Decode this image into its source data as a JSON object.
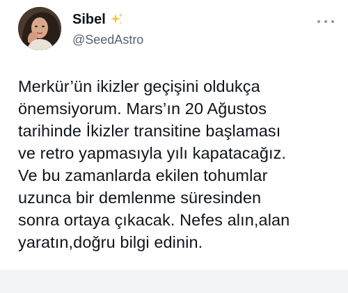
{
  "tweet": {
    "author": {
      "display_name": "Sibel",
      "name_emoji": "sparkles-emoji",
      "handle": "@SeedAstro",
      "avatar": "profile-photo"
    },
    "menu_icon": "more-horizontal-icon",
    "text": "Merkür’ün ikizler geçişini oldukça\nönemsiyorum. Mars’ın 20 Ağustos\ntarihinde İkizler transitine başlaması\nve retro yapmasıyla yılı kapatacağız.\nVe bu zamanlarda ekilen tohumlar\nuzunca bir demlenme süresinden\nsonra ortaya çıkacak. Nefes alın,alan\nyaratın,doğru bilgi edinin."
  },
  "colors": {
    "text_primary": "#0f1419",
    "text_secondary": "#536471",
    "sparkle": "#f5c542",
    "background": "#ffffff",
    "footer": "#f2f3f5"
  }
}
